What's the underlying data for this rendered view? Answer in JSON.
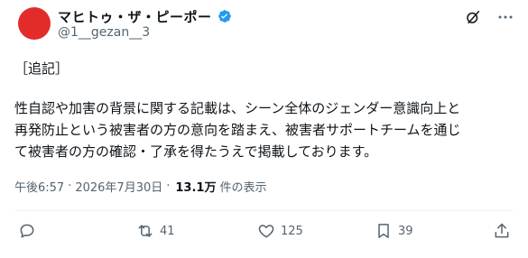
{
  "colors": {
    "avatar": "#e22c2c",
    "verified": "#1d9bf0",
    "text": "#0f1419",
    "muted": "#536471"
  },
  "author": {
    "display_name": "マヒトゥ・ザ・ピーポー",
    "handle": "@1__gezan__3",
    "verified_icon": "verified-badge-icon"
  },
  "post": {
    "addendum": "［追記］",
    "lines": [
      "性自認や加害の背景に関する記載は、シーン全体のジェンダー意識向上と",
      "再発防止という被害者の方の意向を踏まえ、被害者サポートチームを通じ",
      "て被害者の方の確認・了承を得たうえで掲載しております。"
    ]
  },
  "meta": {
    "time": "午後6:57",
    "separator": "·",
    "date": "2026年7月30日",
    "views_count": "13.1万",
    "views_label": "件の表示"
  },
  "actions": {
    "reply": {
      "icon": "reply-icon",
      "count": ""
    },
    "repost": {
      "icon": "repost-icon",
      "count": "41"
    },
    "like": {
      "icon": "heart-icon",
      "count": "125"
    },
    "bookmark": {
      "icon": "bookmark-icon",
      "count": "39"
    },
    "share": {
      "icon": "share-icon",
      "count": ""
    }
  },
  "top_icons": [
    "grok-icon",
    "more-icon"
  ]
}
